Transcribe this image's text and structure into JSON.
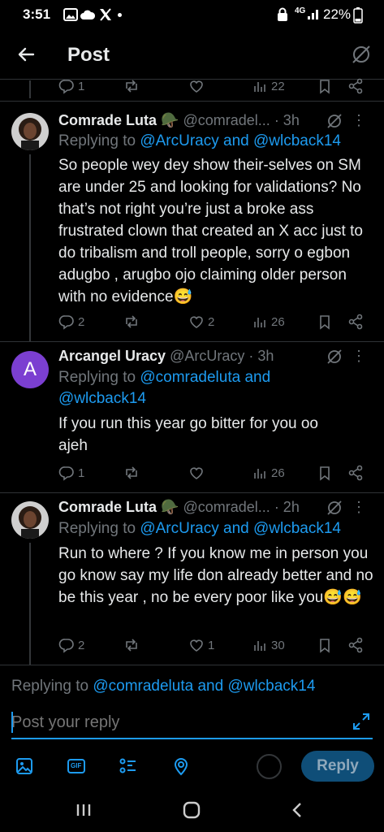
{
  "status": {
    "time": "3:51",
    "battery": "22%",
    "network": "4G"
  },
  "header": {
    "title": "Post"
  },
  "top_stats": {
    "replies": "1",
    "views": "22"
  },
  "posts": [
    {
      "name": "Comrade Luta",
      "emoji": "🪖",
      "handle": "@comradel...",
      "time": "· 3h",
      "replying_prefix": "Replying to ",
      "replying_users": "@ArcUracy and @wlcback14",
      "text": "So people wey dey show their-selves on SM are under 25 and looking for validations? No that’s not right you’re just a broke ass frustrated clown that created an X acc just to do tribalism and troll people, sorry o egbon adugbo , arugbo ojo claiming older person with no evidence😅",
      "replies": "2",
      "reposts": "",
      "likes": "2",
      "views": "26"
    },
    {
      "name": "Arcangel Uracy",
      "avatar_letter": "A",
      "handle": "@ArcUracy",
      "time": "· 3h",
      "replying_prefix": "Replying to ",
      "replying_users": "@comradeluta and @wlcback14",
      "text": "If you run this year go bitter for you oo ajeh",
      "replies": "1",
      "reposts": "",
      "likes": "",
      "views": "26"
    },
    {
      "name": "Comrade Luta",
      "emoji": "🪖",
      "handle": "@comradel...",
      "time": "· 2h",
      "replying_prefix": "Replying to ",
      "replying_users": "@ArcUracy and @wlcback14",
      "text": "Run to where ? If you know me in person you go know say my life don already better and no be this year , no be every poor like you😅😅",
      "replies": "2",
      "reposts": "",
      "likes": "1",
      "views": "30"
    }
  ],
  "composer": {
    "replying_prefix": "Replying to ",
    "replying_users": "@comradeluta and @wlcback14",
    "placeholder": "Post your reply",
    "reply_label": "Reply",
    "gif_label": "GIF"
  },
  "colors": {
    "accent": "#1d9bf0",
    "secondary_text": "#71767b",
    "avatar_a": "#7b3fd1"
  }
}
